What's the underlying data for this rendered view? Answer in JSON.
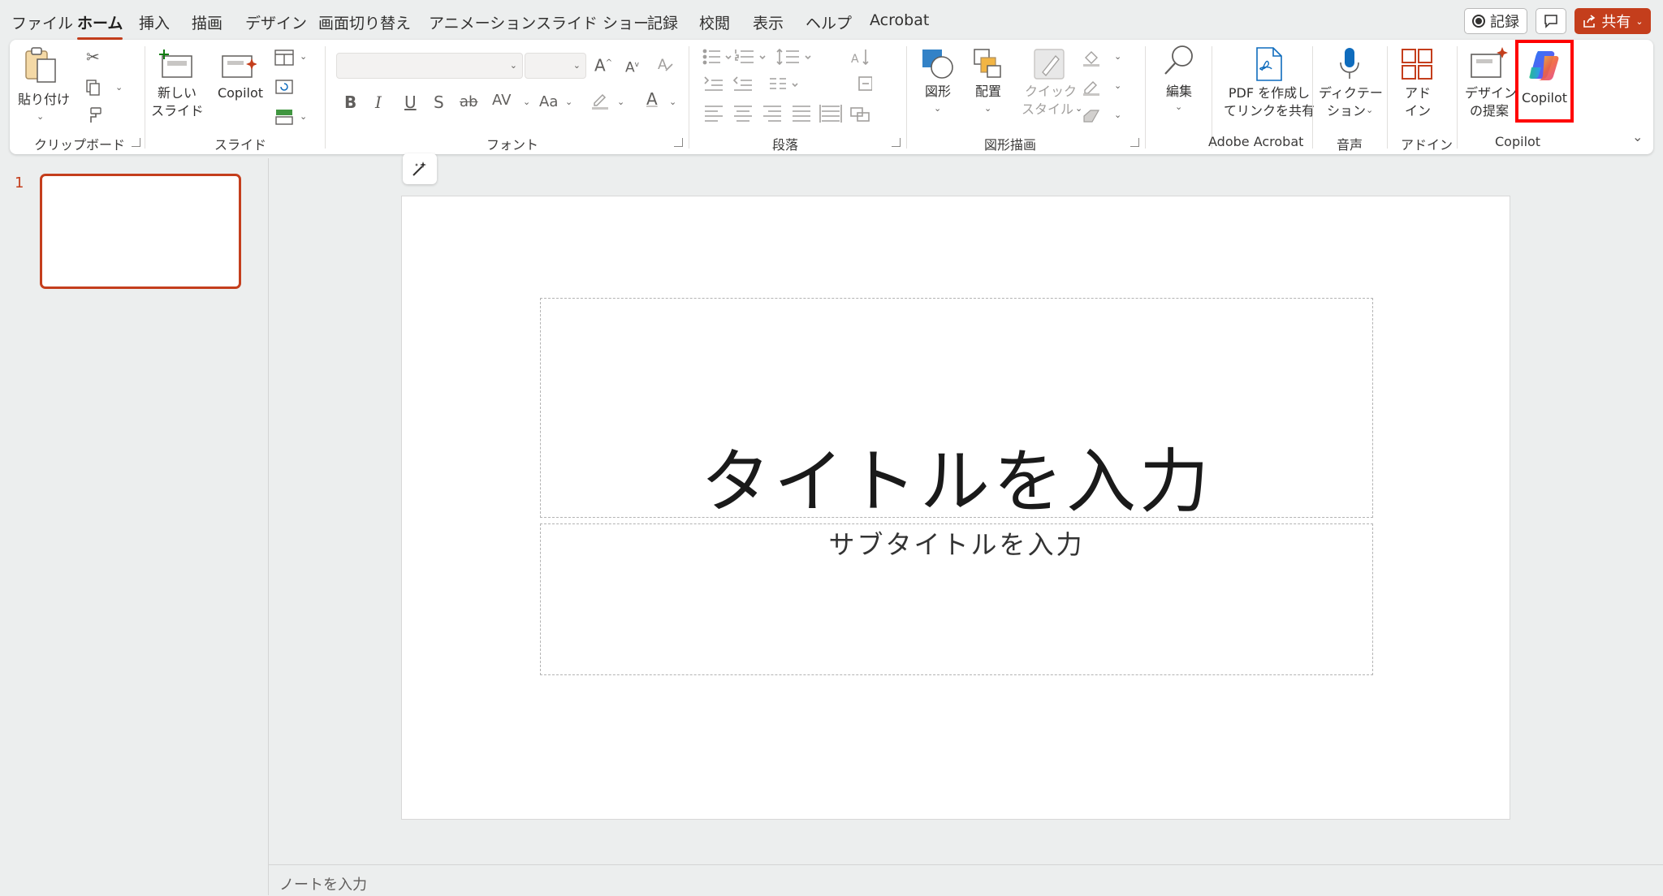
{
  "menu": {
    "tabs": [
      "ファイル",
      "ホーム",
      "挿入",
      "描画",
      "デザイン",
      "画面切り替え",
      "アニメーション",
      "スライド ショー",
      "記録",
      "校閲",
      "表示",
      "ヘルプ",
      "Acrobat"
    ],
    "active_tab": "ホーム",
    "record_button": "記録",
    "share_button": "共有"
  },
  "ribbon": {
    "clipboard": {
      "paste": "貼り付け",
      "group": "クリップボード"
    },
    "slides": {
      "new_slide_1": "新しい",
      "new_slide_2": "スライド",
      "copilot": "Copilot",
      "group": "スライド"
    },
    "font": {
      "group": "フォント",
      "bold": "B",
      "italic": "I",
      "underline": "U",
      "shadow": "S",
      "strike": "ab",
      "spacing": "AV",
      "case": "Aa",
      "color": "A",
      "grow": "A",
      "shrink": "A"
    },
    "paragraph": {
      "group": "段落"
    },
    "drawing": {
      "shapes": "図形",
      "arrange": "配置",
      "quick_style_1": "クイック",
      "quick_style_2": "スタイル",
      "group": "図形描画"
    },
    "editing": {
      "label": "編集"
    },
    "acrobat": {
      "pdf_1": "PDF を作成し",
      "pdf_2": "てリンクを共有",
      "group": "Adobe Acrobat"
    },
    "voice": {
      "dictate_1": "ディクテー",
      "dictate_2": "ション",
      "group": "音声"
    },
    "addins": {
      "label_1": "アド",
      "label_2": "イン",
      "group": "アドイン"
    },
    "copilot": {
      "designer_1": "デザイン",
      "designer_2": "の提案",
      "copilot": "Copilot",
      "group": "Copilot"
    }
  },
  "thumbnails": {
    "slide_number": "1"
  },
  "slide": {
    "title_placeholder": "タイトルを入力",
    "subtitle_placeholder": "サブタイトルを入力"
  },
  "notes": {
    "placeholder": "ノートを入力"
  },
  "colors": {
    "accent": "#c43e1c",
    "highlight": "#ff0000"
  }
}
